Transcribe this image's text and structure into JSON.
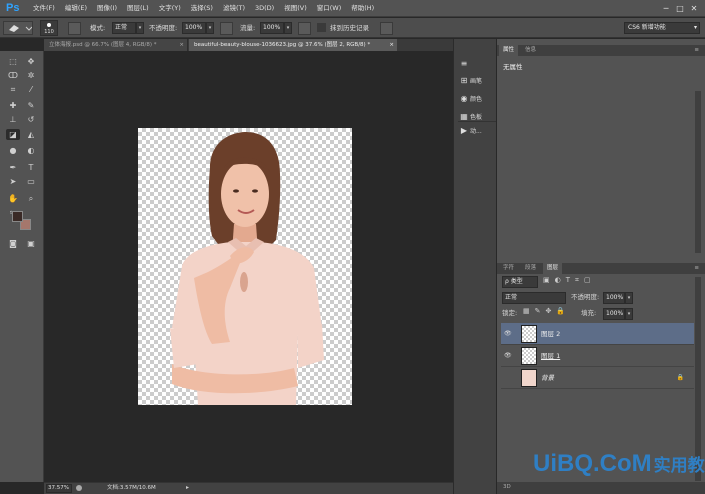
{
  "app": {
    "logo": "Ps"
  },
  "menu": [
    "文件(F)",
    "编辑(E)",
    "图像(I)",
    "图层(L)",
    "文字(Y)",
    "选择(S)",
    "滤镜(T)",
    "3D(D)",
    "视图(V)",
    "窗口(W)",
    "帮助(H)"
  ],
  "window_controls": {
    "minimize": "─",
    "maximize": "□",
    "close": "✕"
  },
  "options": {
    "brush_size": "110",
    "mode_label": "模式:",
    "mode_value": "正常",
    "opacity_label": "不透明度:",
    "opacity_value": "100%",
    "flow_label": "流量:",
    "flow_value": "100%",
    "history_label": "抹到历史记录",
    "workspace": "CS6 新增功能"
  },
  "tabs": [
    {
      "label": "立体海报.psd @ 66.7% (图层 4, RGB/8) *",
      "close": "×"
    },
    {
      "label": "beautiful-beauty-blouse-1036623.jpg @ 37.6% (图层 2, RGB/8) *",
      "close": "×"
    }
  ],
  "status": {
    "zoom": "37.57%",
    "doc_info": "文档:3.57M/10.6M"
  },
  "dock": [
    {
      "icon": "≡",
      "label": ""
    },
    {
      "icon": "⊞",
      "label": "画笔"
    },
    {
      "icon": "◉",
      "label": "颜色"
    },
    {
      "icon": "▦",
      "label": "色板"
    },
    {
      "icon": "▶",
      "label": "动..."
    }
  ],
  "properties": {
    "tabs": [
      "属性",
      "信息"
    ],
    "content": "无属性"
  },
  "layers_panel": {
    "tabs": [
      "字符",
      "段落",
      "图层"
    ],
    "filter_label": "ρ 类型",
    "blend_mode": "正常",
    "opacity_label": "不透明度:",
    "opacity_value": "100%",
    "lock_label": "锁定:",
    "fill_label": "填充:",
    "fill_value": "100%",
    "layers": [
      {
        "name": "图层 2",
        "selected": true,
        "visible": true
      },
      {
        "name": "图层 1",
        "selected": false,
        "visible": true
      },
      {
        "name": "背景",
        "selected": false,
        "visible": false,
        "locked": true
      }
    ]
  },
  "bottom_tab": "3D",
  "watermark": {
    "latin": "UiBQ.CoM",
    "cn": "实用教程"
  },
  "colors": {
    "accent": "#2fa3ff",
    "selected_layer": "#5d6d88",
    "foreground": "#3a2a26",
    "background": "#a5776c"
  }
}
